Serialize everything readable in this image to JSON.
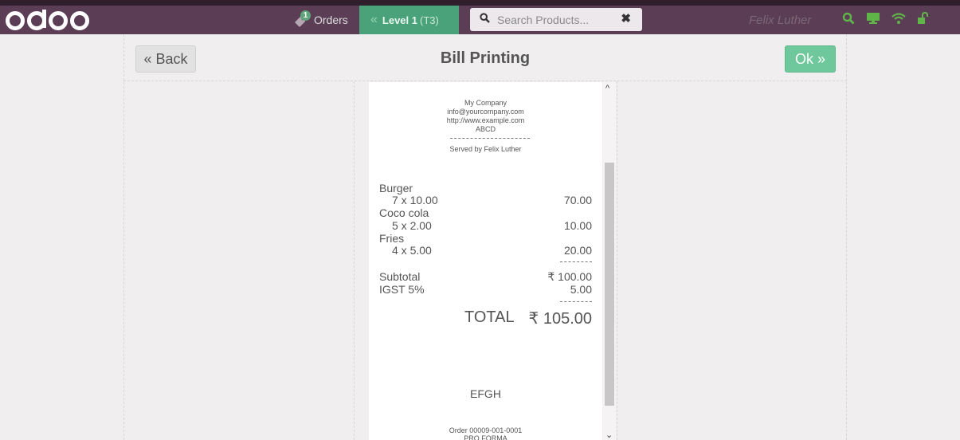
{
  "topbar": {
    "logo_text": "odoo",
    "orders_label": "Orders",
    "orders_count": "1",
    "floor_level": "Level 1",
    "floor_table": "(T3)",
    "search_placeholder": "Search Products...",
    "user_name": "Felix Luther",
    "icons": [
      "tag-icon",
      "chevron-left-double-icon",
      "search-icon",
      "close-icon",
      "proxy-search-icon",
      "screen-icon",
      "wifi-icon",
      "unlock-icon"
    ]
  },
  "screen": {
    "title": "Bill Printing",
    "back_label": "« Back",
    "ok_label": "Ok »"
  },
  "receipt": {
    "company_name": "My Company",
    "email": "info@yourcompany.com",
    "website": "http://www.example.com",
    "header_text": "ABCD",
    "served_by": "Served by Felix Luther",
    "lines": [
      {
        "name": "Burger",
        "qty": "7 x 10.00",
        "amount": "70.00"
      },
      {
        "name": "Coco cola",
        "qty": "5 x 2.00",
        "amount": "10.00"
      },
      {
        "name": "Fries",
        "qty": "4 x 5.00",
        "amount": "20.00"
      }
    ],
    "separator": "--------",
    "subtotal_label": "Subtotal",
    "subtotal_value": "₹ 100.00",
    "tax_label": "IGST 5%",
    "tax_value": "5.00",
    "total_label": "TOTAL",
    "total_value": "₹ 105.00",
    "footer_text": "EFGH",
    "order_number": "Order 00009-001-0001",
    "order_type": "PRO FORMA"
  },
  "colors": {
    "topbar": "#5b3e55",
    "topbar_top": "#2f1f2c",
    "floor_green": "#4aa27a",
    "ok_green": "#6ec89b",
    "status_green": "#5fb548"
  }
}
